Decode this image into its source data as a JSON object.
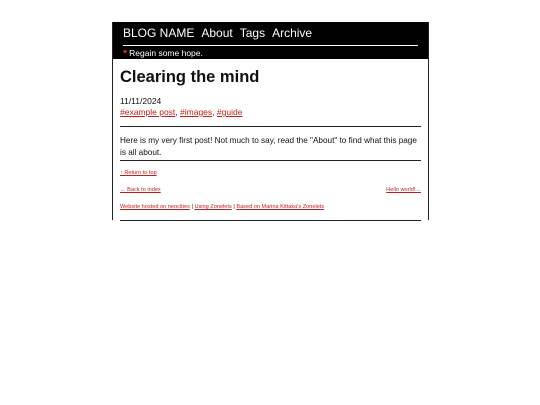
{
  "nav": {
    "brand": "BLOG NAME",
    "links": [
      "About",
      "Tags",
      "Archive"
    ]
  },
  "tagline": {
    "icon": "heart-icon",
    "text": "Regain some hope."
  },
  "post": {
    "title": "Clearing the mind",
    "date": "11/11/2024",
    "tags": [
      "#example post",
      "#images",
      "#guide"
    ],
    "body": "Here is my very first post! Not much to say, read the \"About\" to find what this page is all about."
  },
  "footer": {
    "return_to_top": "↑ Return to top",
    "back_to_index": "← Back to index",
    "next_post": "Hello world!→",
    "links": [
      "Website hosted on neocities",
      "Using Zonelets",
      "Based on Marina Kittaka's Zonelets"
    ],
    "separator": "|"
  },
  "colors": {
    "header_bg": "#000000",
    "link": "#c0201b",
    "heart": "#e0302e"
  }
}
